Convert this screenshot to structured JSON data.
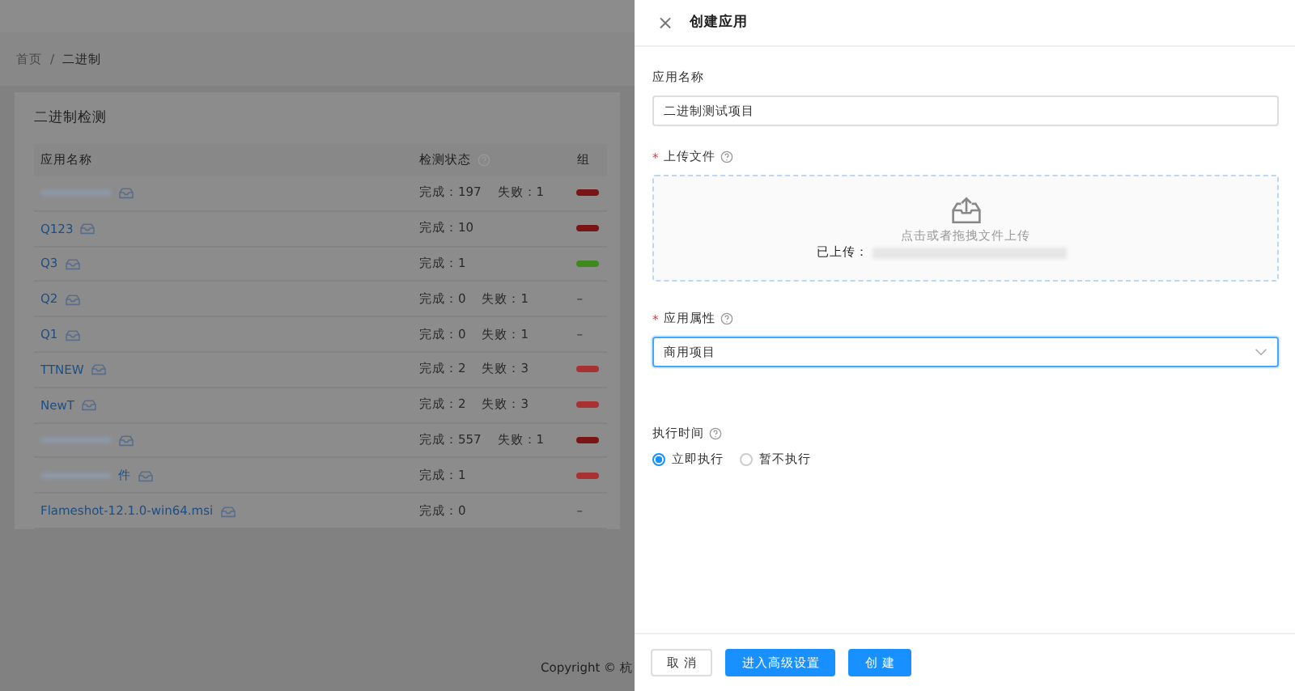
{
  "breadcrumb": [
    {
      "label": "首页"
    },
    {
      "label": "二进制"
    }
  ],
  "breadcrumb_separator": "/",
  "card": {
    "title": "二进制检测",
    "columns": [
      {
        "label": "应用名称",
        "help": false
      },
      {
        "label": "检测状态",
        "help": true
      },
      {
        "label": "组",
        "help": false
      }
    ],
    "rows": [
      {
        "name": "",
        "redacted": true,
        "done": "完成：197",
        "failed": "失败：1",
        "color": "#7a1515"
      },
      {
        "name": "Q123",
        "redacted": false,
        "done": "完成：10",
        "failed": "",
        "color": "#7a1515"
      },
      {
        "name": "Q3",
        "redacted": false,
        "done": "完成：1",
        "failed": "",
        "color": "#3f8a1f"
      },
      {
        "name": "Q2",
        "redacted": false,
        "done": "完成：0",
        "failed": "失败：1",
        "dash": "–"
      },
      {
        "name": "Q1",
        "redacted": false,
        "done": "完成：0",
        "failed": "失败：1",
        "dash": "–"
      },
      {
        "name": "TTNEW",
        "redacted": false,
        "done": "完成：2",
        "failed": "失败：3",
        "color": "#a83232"
      },
      {
        "name": "NewT",
        "redacted": false,
        "done": "完成：2",
        "failed": "失败：3",
        "color": "#a83232"
      },
      {
        "name": "",
        "redacted": true,
        "done": "完成：557",
        "failed": "失败：1",
        "color": "#7a1515"
      },
      {
        "name": "件",
        "redacted": true,
        "done": "完成：1",
        "failed": "",
        "color": "#a83232"
      },
      {
        "name": "Flameshot-12.1.0-win64.msi",
        "redacted": false,
        "done": "完成：0",
        "failed": "",
        "dash": "–"
      }
    ]
  },
  "footer": {
    "copyright": "Copyright © 杭"
  },
  "drawer": {
    "close": "×",
    "title": "创建应用",
    "required_mark": "*",
    "name_field": {
      "label": "应用名称",
      "required": false,
      "help": false,
      "value": "二进制测试项目"
    },
    "upload": {
      "label": "上传文件",
      "required": true,
      "help": true,
      "hint": "点击或者拖拽文件上传",
      "uploaded_label": "已上传：",
      "uploaded_redacted": true
    },
    "attribute": {
      "label": "应用属性",
      "required": true,
      "help": true,
      "value": "商用项目"
    },
    "exec_time": {
      "label": "执行时间",
      "required": false,
      "help": true,
      "options": [
        {
          "label": "立即执行",
          "selected": true
        },
        {
          "label": "暂不执行",
          "selected": false
        }
      ]
    },
    "buttons": [
      {
        "label": "取 消",
        "kind": "default"
      },
      {
        "label": "进入高级设置",
        "kind": "primary"
      },
      {
        "label": "创 建",
        "kind": "primary"
      }
    ]
  }
}
